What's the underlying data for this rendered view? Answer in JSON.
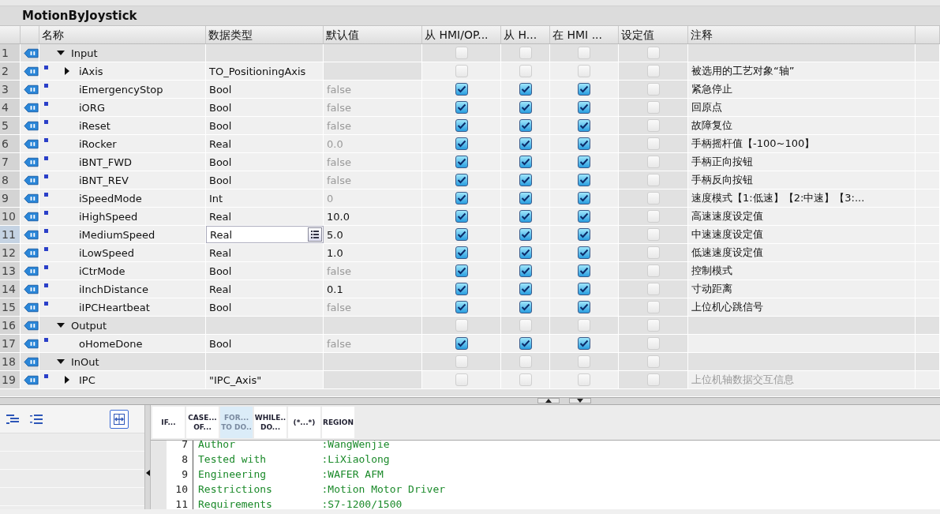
{
  "block": {
    "title": "MotionByJoystick"
  },
  "columns": [
    "名称",
    "数据类型",
    "默认值",
    "从 HMI/OP...",
    "从 H...",
    "在 HMI ...",
    "设定值",
    "注释"
  ],
  "rows": [
    {
      "number": "1",
      "kind": "section",
      "expanded": true,
      "name": "Input",
      "type": "",
      "default": "",
      "access": false,
      "visible": false,
      "writable": false,
      "setpoint": false,
      "comment": "",
      "selected": false
    },
    {
      "number": "2",
      "kind": "struct",
      "expanded": false,
      "name": "iAxis",
      "type": "TO_PositioningAxis",
      "default": "",
      "access": false,
      "visible": false,
      "writable": false,
      "setpoint": false,
      "comment": "被选用的工艺对象“轴”",
      "comment_dim": false,
      "selected": false
    },
    {
      "number": "3",
      "kind": "member",
      "name": "iEmergencyStop",
      "type": "Bool",
      "default": "false",
      "default_dim": true,
      "access": true,
      "visible": true,
      "writable": true,
      "setpoint": false,
      "comment": "紧急停止",
      "comment_dim": false,
      "selected": false
    },
    {
      "number": "4",
      "kind": "member",
      "name": "iORG",
      "type": "Bool",
      "default": "false",
      "default_dim": true,
      "access": true,
      "visible": true,
      "writable": true,
      "setpoint": false,
      "comment": "回原点",
      "comment_dim": false,
      "selected": false
    },
    {
      "number": "5",
      "kind": "member",
      "name": "iReset",
      "type": "Bool",
      "default": "false",
      "default_dim": true,
      "access": true,
      "visible": true,
      "writable": true,
      "setpoint": false,
      "comment": "故障复位",
      "comment_dim": false,
      "selected": false
    },
    {
      "number": "6",
      "kind": "member",
      "name": "iRocker",
      "type": "Real",
      "default": "0.0",
      "default_dim": true,
      "access": true,
      "visible": true,
      "writable": true,
      "setpoint": false,
      "comment": "手柄摇杆值【-100~100】",
      "comment_dim": false,
      "selected": false
    },
    {
      "number": "7",
      "kind": "member",
      "name": "iBNT_FWD",
      "type": "Bool",
      "default": "false",
      "default_dim": true,
      "access": true,
      "visible": true,
      "writable": true,
      "setpoint": false,
      "comment": "手柄正向按钮",
      "comment_dim": false,
      "selected": false
    },
    {
      "number": "8",
      "kind": "member",
      "name": "iBNT_REV",
      "type": "Bool",
      "default": "false",
      "default_dim": true,
      "access": true,
      "visible": true,
      "writable": true,
      "setpoint": false,
      "comment": "手柄反向按钮",
      "comment_dim": false,
      "selected": false
    },
    {
      "number": "9",
      "kind": "member",
      "name": "iSpeedMode",
      "type": "Int",
      "default": "0",
      "default_dim": true,
      "access": true,
      "visible": true,
      "writable": true,
      "setpoint": false,
      "comment": "速度模式【1:低速】【2:中速】【3:...",
      "comment_dim": false,
      "selected": false
    },
    {
      "number": "10",
      "kind": "member",
      "name": "iHighSpeed",
      "type": "Real",
      "default": "10.0",
      "default_dim": false,
      "access": true,
      "visible": true,
      "writable": true,
      "setpoint": false,
      "comment": "高速速度设定值",
      "comment_dim": false,
      "selected": false
    },
    {
      "number": "11",
      "kind": "member",
      "name": "iMediumSpeed",
      "type": "Real",
      "default": "5.0",
      "default_dim": false,
      "access": true,
      "visible": true,
      "writable": true,
      "setpoint": false,
      "comment": "中速速度设定值",
      "comment_dim": false,
      "selected": true
    },
    {
      "number": "12",
      "kind": "member",
      "name": "iLowSpeed",
      "type": "Real",
      "default": "1.0",
      "default_dim": false,
      "access": true,
      "visible": true,
      "writable": true,
      "setpoint": false,
      "comment": "低速速度设定值",
      "comment_dim": false,
      "selected": false
    },
    {
      "number": "13",
      "kind": "member",
      "name": "iCtrMode",
      "type": "Bool",
      "default": "false",
      "default_dim": true,
      "access": true,
      "visible": true,
      "writable": true,
      "setpoint": false,
      "comment": "控制模式",
      "comment_dim": false,
      "selected": false
    },
    {
      "number": "14",
      "kind": "member",
      "name": "iInchDistance",
      "type": "Real",
      "default": "0.1",
      "default_dim": false,
      "access": true,
      "visible": true,
      "writable": true,
      "setpoint": false,
      "comment": "寸动距离",
      "comment_dim": false,
      "selected": false
    },
    {
      "number": "15",
      "kind": "member",
      "name": "iIPCHeartbeat",
      "type": "Bool",
      "default": "false",
      "default_dim": true,
      "access": true,
      "visible": true,
      "writable": true,
      "setpoint": false,
      "comment": "上位机心跳信号",
      "comment_dim": false,
      "selected": false
    },
    {
      "number": "16",
      "kind": "section",
      "expanded": true,
      "name": "Output",
      "type": "",
      "default": "",
      "access": false,
      "visible": false,
      "writable": false,
      "setpoint": false,
      "comment": "",
      "selected": false
    },
    {
      "number": "17",
      "kind": "member",
      "name": "oHomeDone",
      "type": "Bool",
      "default": "false",
      "default_dim": true,
      "access": true,
      "visible": true,
      "writable": true,
      "setpoint": false,
      "comment": "",
      "selected": false
    },
    {
      "number": "18",
      "kind": "section",
      "expanded": true,
      "name": "InOut",
      "type": "",
      "default": "",
      "access": false,
      "visible": false,
      "writable": false,
      "setpoint": false,
      "comment": "",
      "selected": false
    },
    {
      "number": "19",
      "kind": "struct",
      "expanded": false,
      "name": "IPC",
      "type": "\"IPC_Axis\"",
      "default": "",
      "access": false,
      "visible": false,
      "writable": false,
      "setpoint": false,
      "comment": "上位机轴数据交互信息",
      "comment_dim": true,
      "selected": false
    }
  ],
  "instructions": [
    {
      "label": "IF...",
      "selected": false
    },
    {
      "label": "CASE... OF...",
      "selected": false
    },
    {
      "label": "FOR... TO DO..",
      "selected": true
    },
    {
      "label": "WHILE.. DO...",
      "selected": false
    },
    {
      "label": "(*...*)",
      "selected": false
    },
    {
      "label": "REGION",
      "selected": false
    }
  ],
  "code": [
    {
      "line": "7",
      "text": "Author              :WangWenjie"
    },
    {
      "line": "8",
      "text": "Tested with         :LiXiaolong"
    },
    {
      "line": "9",
      "text": "Engineering         :WAFER AFM"
    },
    {
      "line": "10",
      "text": "Restrictions        :Motion Motor Driver"
    },
    {
      "line": "11",
      "text": "Requirements        :S7-1200/1500"
    }
  ]
}
